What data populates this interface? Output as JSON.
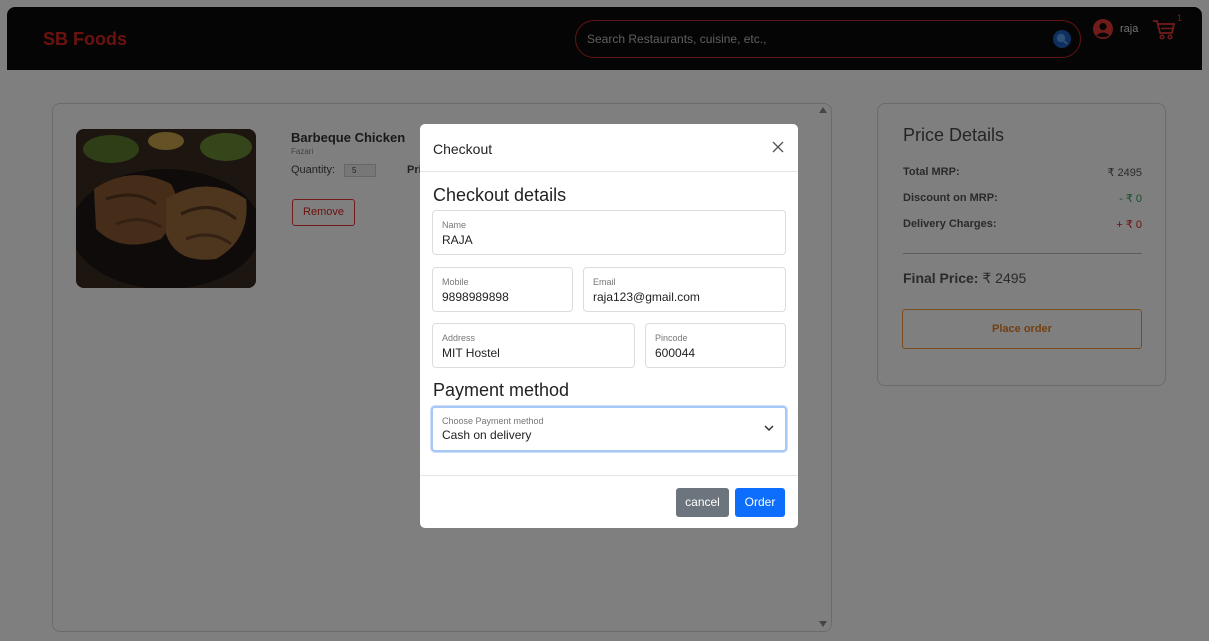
{
  "navbar": {
    "brand": "SB Foods",
    "search_placeholder": "Search Restaurants, cuisine, etc.,",
    "user_name": "raja",
    "cart_count": "1"
  },
  "cart": {
    "item": {
      "name": "Barbeque Chicken",
      "restaurant": "Fazari",
      "quantity_label": "Quantity:",
      "quantity": "5",
      "price_label": "Pri",
      "remove_label": "Remove"
    }
  },
  "price_details": {
    "title": "Price Details",
    "rows": [
      {
        "label": "Total MRP:",
        "value": "₹ 2495",
        "color": "#555555"
      },
      {
        "label": "Discount on MRP:",
        "value": "- ₹ 0",
        "color": "#2e9e4f"
      },
      {
        "label": "Delivery Charges:",
        "value": "+ ₹ 0",
        "color": "#d9251d"
      }
    ],
    "final_label": "Final Price:",
    "final_value": "₹ 2495",
    "place_order_label": "Place order"
  },
  "modal": {
    "title": "Checkout",
    "details_heading": "Checkout details",
    "fields": {
      "name": {
        "label": "Name",
        "value": "RAJA"
      },
      "mobile": {
        "label": "Mobile",
        "value": "9898989898"
      },
      "email": {
        "label": "Email",
        "value": "raja123@gmail.com"
      },
      "address": {
        "label": "Address",
        "value": "MIT Hostel"
      },
      "pincode": {
        "label": "Pincode",
        "value": "600044"
      }
    },
    "payment_heading": "Payment method",
    "payment": {
      "label": "Choose Payment method",
      "value": "Cash on delivery"
    },
    "cancel_label": "cancel",
    "order_label": "Order"
  },
  "colors": {
    "brand": "#d9251d",
    "primary": "#0d6efd",
    "secondary": "#6c757d",
    "accent_orange": "#e67e22"
  }
}
